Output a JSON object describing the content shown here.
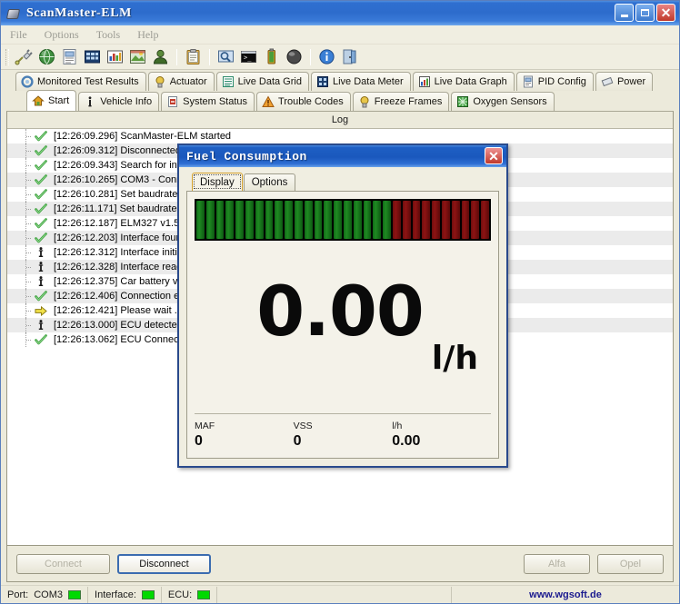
{
  "window": {
    "title": "ScanMaster-ELM",
    "min_label": "Minimize",
    "max_label": "Maximize",
    "close_label": "✕"
  },
  "menu": {
    "items": [
      {
        "label": "File"
      },
      {
        "label": "Options"
      },
      {
        "label": "Tools"
      },
      {
        "label": "Help"
      }
    ]
  },
  "toolbar": {
    "icons": [
      {
        "name": "connect-plug-icon"
      },
      {
        "name": "globe-icon"
      },
      {
        "name": "report-icon"
      },
      {
        "name": "grid-icon"
      },
      {
        "name": "chart-icon"
      },
      {
        "name": "image-icon"
      },
      {
        "name": "user-icon"
      },
      {
        "name": "clipboard-icon"
      },
      {
        "name": "search-monitor-icon"
      },
      {
        "name": "terminal-icon"
      },
      {
        "name": "battery-icon"
      },
      {
        "name": "sphere-icon"
      },
      {
        "name": "info-icon"
      },
      {
        "name": "exit-icon"
      }
    ]
  },
  "tabs": {
    "row1": [
      {
        "label": "Monitored Test Results",
        "icon": "gear-icon",
        "active": false
      },
      {
        "label": "Actuator",
        "icon": "bulb-icon",
        "active": false
      },
      {
        "label": "Live Data Grid",
        "icon": "list-icon",
        "active": false
      },
      {
        "label": "Live Data Meter",
        "icon": "meter-grid-icon",
        "active": false
      },
      {
        "label": "Live Data Graph",
        "icon": "bar-chart-icon",
        "active": false
      },
      {
        "label": "PID Config",
        "icon": "pid-doc-icon",
        "active": false
      },
      {
        "label": "Power",
        "icon": "power-icon",
        "active": false
      }
    ],
    "row2": [
      {
        "label": "Start",
        "icon": "home-icon",
        "active": true
      },
      {
        "label": "Vehicle Info",
        "icon": "info-i-icon",
        "active": false
      },
      {
        "label": "System Status",
        "icon": "status-doc-icon",
        "active": false
      },
      {
        "label": "Trouble Codes",
        "icon": "warning-icon",
        "active": false
      },
      {
        "label": "Freeze Frames",
        "icon": "bulb-icon",
        "active": false
      },
      {
        "label": "Oxygen Sensors",
        "icon": "o2-icon",
        "active": false
      }
    ]
  },
  "log": {
    "header": "Log",
    "rows": [
      {
        "status": "ok",
        "time": "[12:26:09.296]",
        "message": "ScanMaster-ELM started"
      },
      {
        "status": "ok",
        "time": "[12:26:09.312]",
        "message": "Disconnected"
      },
      {
        "status": "ok",
        "time": "[12:26:09.343]",
        "message": "Search for interface ..."
      },
      {
        "status": "ok",
        "time": "[12:26:10.265]",
        "message": "COM3 - Connected"
      },
      {
        "status": "ok",
        "time": "[12:26:10.281]",
        "message": "Set baudrate to 38400"
      },
      {
        "status": "ok",
        "time": "[12:26:11.171]",
        "message": "Set baudrate to 38400"
      },
      {
        "status": "ok",
        "time": "[12:26:12.187]",
        "message": "ELM327 v1.5"
      },
      {
        "status": "ok",
        "time": "[12:26:12.203]",
        "message": "Interface found"
      },
      {
        "status": "info",
        "time": "[12:26:12.312]",
        "message": "Interface initialized"
      },
      {
        "status": "info",
        "time": "[12:26:12.328]",
        "message": "Interface ready"
      },
      {
        "status": "info",
        "time": "[12:26:12.375]",
        "message": "Car battery voltage 12.4 V"
      },
      {
        "status": "ok",
        "time": "[12:26:12.406]",
        "message": "Connection established"
      },
      {
        "status": "wait",
        "time": "[12:26:12.421]",
        "message": "Please wait ..."
      },
      {
        "status": "info",
        "time": "[12:26:13.000]",
        "message": "ECU detected"
      },
      {
        "status": "ok",
        "time": "[12:26:13.062]",
        "message": "ECU Connected"
      }
    ]
  },
  "buttons": {
    "connect": "Connect",
    "disconnect": "Disconnect",
    "alfa": "Alfa",
    "opel": "Opel"
  },
  "statusbar": {
    "port_label": "Port:",
    "port_value": "COM3",
    "interface_label": "Interface:",
    "ecu_label": "ECU:",
    "url": "www.wgsoft.de",
    "led_color": "#00d900"
  },
  "dialog": {
    "title": "Fuel Consumption",
    "close_label": "✕",
    "tabs": [
      {
        "label": "Display",
        "active": true
      },
      {
        "label": "Options",
        "active": false
      }
    ],
    "gauge": {
      "total_segments": 30,
      "green_segments": 20,
      "green_color": "#1f8a22",
      "red_color": "#8e1313",
      "background": "#000000"
    },
    "value": "0.00",
    "unit": "l/h",
    "stats": [
      {
        "label": "MAF",
        "value": "0"
      },
      {
        "label": "VSS",
        "value": "0"
      },
      {
        "label": "l/h",
        "value": "0.00"
      }
    ]
  }
}
